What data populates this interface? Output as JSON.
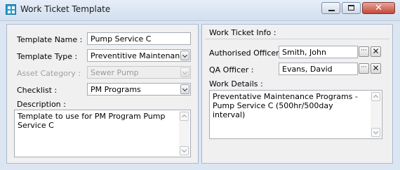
{
  "window": {
    "title": "Work Ticket Template",
    "minimize_glyph": "",
    "close_glyph": "✕"
  },
  "left": {
    "template_name_label": "Template Name :",
    "template_name_value": "Pump Service C",
    "template_type_label": "Template Type :",
    "template_type_value": "Preventitive Maintenance",
    "asset_category_label": "Asset Category :",
    "asset_category_value": "Sewer Pump",
    "checklist_label": "Checklist :",
    "checklist_value": "PM Programs",
    "description_label": "Description :",
    "description_value": "Template to use for PM Program Pump Service C"
  },
  "right": {
    "section_title": "Work Ticket Info :",
    "authorised_officer_label": "Authorised Officer :",
    "authorised_officer_value": "Smith, John",
    "qa_officer_label": "QA Officer :",
    "qa_officer_value": "Evans, David",
    "work_details_label": "Work Details :",
    "work_details_value": "Preventative Maintenance Programs - Pump Service C (500hr/500day interval)",
    "lookup_glyph": "···",
    "clear_glyph": "✕"
  }
}
